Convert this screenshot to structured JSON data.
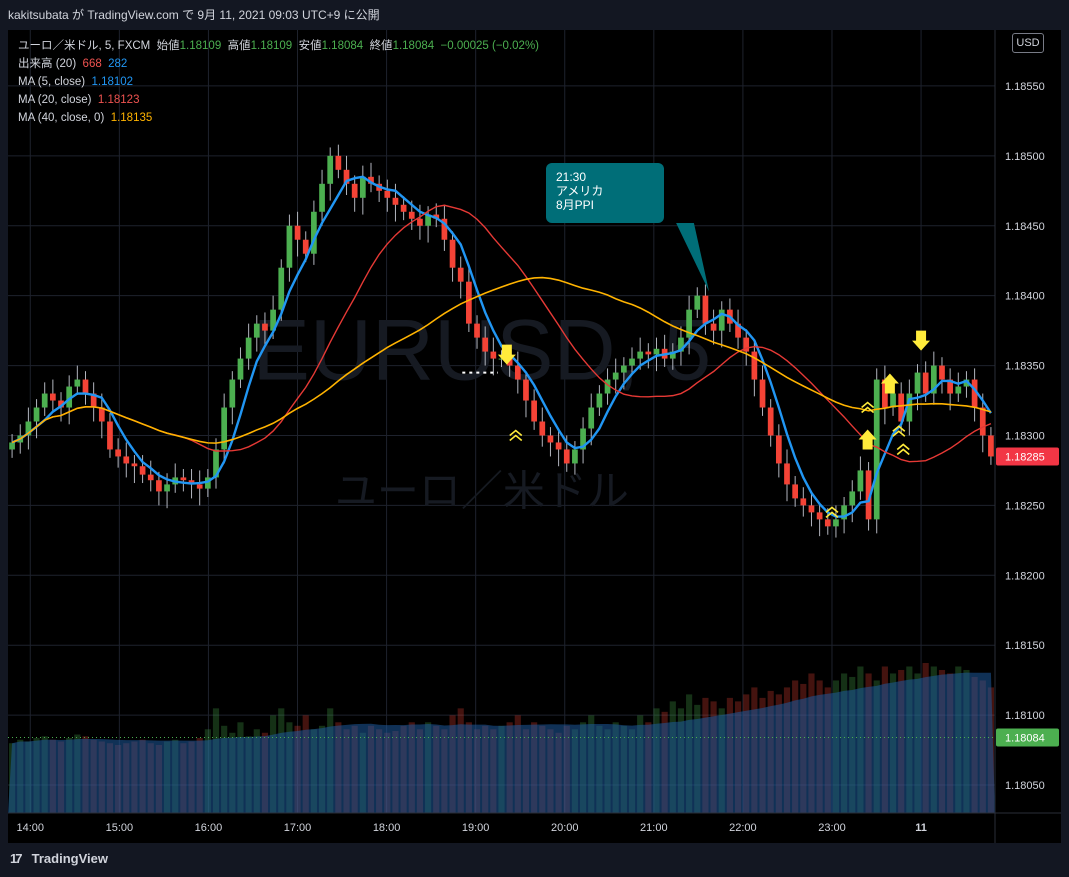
{
  "header": {
    "attribution": "kakitsubata が TradingView.com で 9月 11, 2021 09:03 UTC+9 に公開"
  },
  "legend": {
    "symbol": "ユーロ／米ドル, 5, FXCM",
    "open_label": "始値",
    "open": "1.18109",
    "high_label": "高値",
    "high": "1.18109",
    "low_label": "安値",
    "low": "1.18084",
    "close_label": "終値",
    "close": "1.18084",
    "change": "−0.00025 (−0.02%)",
    "volume_label": "出来高 (20)",
    "volume_a": "668",
    "volume_b": "282",
    "ma5_label": "MA (5, close)",
    "ma5": "1.18102",
    "ma20_label": "MA (20, close)",
    "ma20": "1.18123",
    "ma40_label": "MA (40, close, 0)",
    "ma40": "1.18135"
  },
  "currency_button": "USD",
  "watermark": {
    "symbol": "EURUSD, 5",
    "name": "ユーロ／米ドル"
  },
  "callout": {
    "line1": "21:30",
    "line2": "アメリカ",
    "line3": "8月PPI"
  },
  "footer": {
    "brand": "TradingView",
    "logo_mark": "17"
  },
  "colors": {
    "up": "#4caf50",
    "down": "#f44336",
    "ma5": "#2196f3",
    "ma20": "#e53935",
    "ma40": "#ffb300",
    "arrow": "#ffeb3b",
    "callout": "#006e78"
  },
  "chart_data": {
    "type": "candlestick",
    "ylim": [
      1.1803,
      1.1859
    ],
    "y_ticks": [
      "1.18550",
      "1.18500",
      "1.18450",
      "1.18400",
      "1.18350",
      "1.18300",
      "1.18250",
      "1.18200",
      "1.18150",
      "1.18100",
      "1.18050"
    ],
    "x_range": [
      13.75,
      24.83
    ],
    "x_ticks": [
      {
        "label": "14:00",
        "t": 14
      },
      {
        "label": "15:00",
        "t": 15
      },
      {
        "label": "16:00",
        "t": 16
      },
      {
        "label": "17:00",
        "t": 17
      },
      {
        "label": "18:00",
        "t": 18
      },
      {
        "label": "19:00",
        "t": 19
      },
      {
        "label": "20:00",
        "t": 20
      },
      {
        "label": "21:00",
        "t": 21
      },
      {
        "label": "22:00",
        "t": 22
      },
      {
        "label": "23:00",
        "t": 23
      },
      {
        "label": "11",
        "t": 24
      }
    ],
    "price_labels": [
      {
        "value": "1.18285",
        "y": 1.18285,
        "color": "#f23645"
      },
      {
        "value": "1.18084",
        "y": 1.18084,
        "color": "#4caf50"
      }
    ],
    "closes": [
      1.18295,
      1.183,
      1.1831,
      1.1832,
      1.1833,
      1.18325,
      1.1832,
      1.18335,
      1.1834,
      1.1833,
      1.1832,
      1.1831,
      1.1829,
      1.18285,
      1.1828,
      1.18278,
      1.18272,
      1.18268,
      1.1826,
      1.18265,
      1.1827,
      1.18268,
      1.18265,
      1.18262,
      1.1827,
      1.1829,
      1.1832,
      1.1834,
      1.18355,
      1.1837,
      1.1838,
      1.18375,
      1.1839,
      1.1842,
      1.1845,
      1.1844,
      1.1843,
      1.1846,
      1.1848,
      1.185,
      1.1849,
      1.1848,
      1.1847,
      1.18485,
      1.1848,
      1.18475,
      1.1847,
      1.18465,
      1.1846,
      1.18455,
      1.1845,
      1.18458,
      1.18455,
      1.1844,
      1.1842,
      1.1841,
      1.1838,
      1.1837,
      1.1836,
      1.18355,
      1.18355,
      1.1835,
      1.1834,
      1.18325,
      1.1831,
      1.183,
      1.18295,
      1.1829,
      1.1828,
      1.1829,
      1.18305,
      1.1832,
      1.1833,
      1.1834,
      1.18345,
      1.1835,
      1.18355,
      1.1836,
      1.18358,
      1.18362,
      1.18355,
      1.1836,
      1.1837,
      1.1839,
      1.184,
      1.1838,
      1.18375,
      1.1839,
      1.1838,
      1.1837,
      1.1836,
      1.1834,
      1.1832,
      1.183,
      1.1828,
      1.18265,
      1.18255,
      1.1825,
      1.18245,
      1.1824,
      1.18235,
      1.1824,
      1.1825,
      1.1826,
      1.18275,
      1.1824,
      1.1834,
      1.1832,
      1.1833,
      1.1831,
      1.1833,
      1.18345,
      1.1833,
      1.1835,
      1.1834,
      1.1833,
      1.18335,
      1.1834,
      1.1832,
      1.183,
      1.18285
    ],
    "volumes": [
      200,
      210,
      205,
      215,
      220,
      210,
      205,
      215,
      225,
      220,
      210,
      205,
      200,
      195,
      200,
      205,
      210,
      200,
      195,
      205,
      210,
      200,
      205,
      215,
      240,
      300,
      250,
      230,
      260,
      220,
      240,
      230,
      280,
      300,
      260,
      250,
      280,
      240,
      250,
      300,
      260,
      240,
      250,
      230,
      250,
      240,
      230,
      235,
      250,
      260,
      240,
      260,
      250,
      240,
      280,
      300,
      260,
      240,
      250,
      240,
      250,
      260,
      280,
      240,
      260,
      250,
      240,
      230,
      250,
      240,
      260,
      280,
      250,
      240,
      260,
      250,
      240,
      280,
      260,
      300,
      290,
      320,
      300,
      340,
      310,
      330,
      320,
      300,
      330,
      320,
      340,
      360,
      330,
      350,
      340,
      360,
      380,
      370,
      400,
      380,
      360,
      380,
      400,
      390,
      420,
      400,
      380,
      420,
      400,
      410,
      420,
      400,
      430,
      420,
      410,
      400,
      420,
      410,
      390,
      380,
      360
    ],
    "series": [
      {
        "name": "MA (5, close)"
      },
      {
        "name": "MA (20, close)"
      },
      {
        "name": "MA (40, close, 0)"
      }
    ]
  }
}
